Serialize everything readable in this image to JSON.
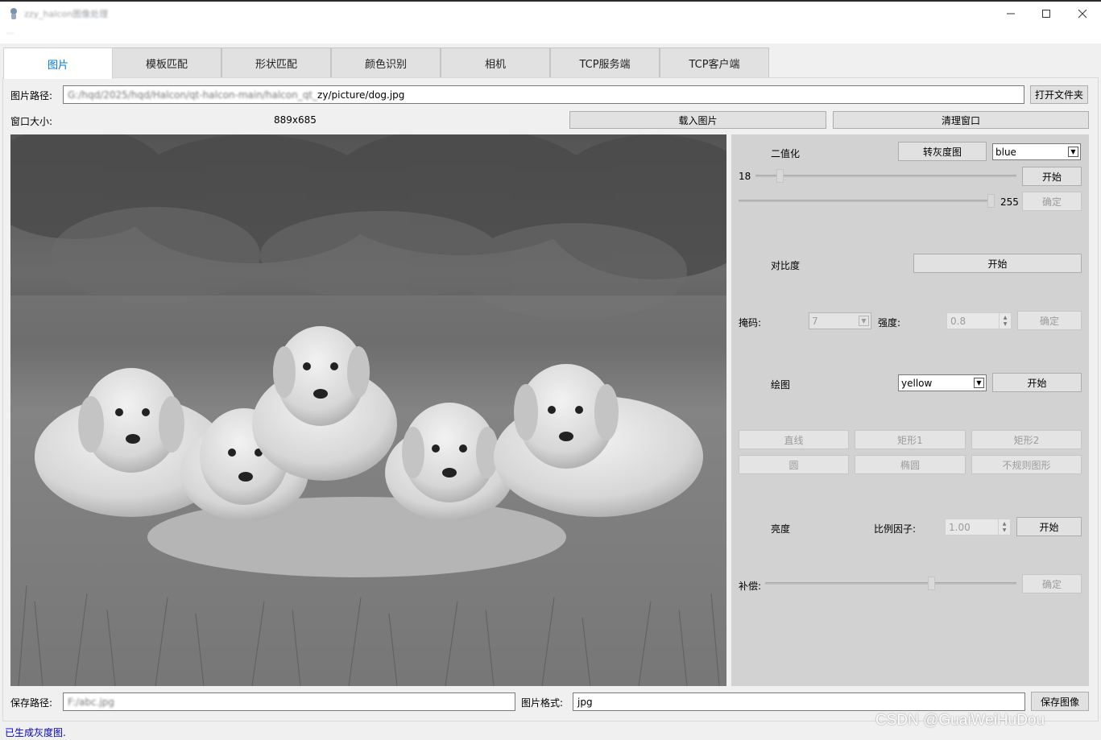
{
  "window": {
    "title": "zzy_halcon图像处理",
    "menu": "···",
    "minimize_icon": "minimize-icon",
    "maximize_icon": "maximize-icon",
    "close_icon": "close-icon"
  },
  "tabs": [
    {
      "label": "图片",
      "active": true
    },
    {
      "label": "模板匹配"
    },
    {
      "label": "形状匹配"
    },
    {
      "label": "颜色识别"
    },
    {
      "label": "相机"
    },
    {
      "label": "TCP服务端"
    },
    {
      "label": "TCP客户端"
    }
  ],
  "picture": {
    "path_label": "图片路径:",
    "path_prefix": "G:/hqd/2025/hqd/Halcon/qt-halcon-main/halcon_qt_",
    "path_value": "zy/picture/dog.jpg",
    "open_folder_label": "打开文件夹",
    "window_size_label": "窗口大小:",
    "window_size_value": "889x685",
    "load_image_label": "载入图片",
    "clear_window_label": "清理窗口"
  },
  "panel": {
    "binarize_label": "二值化",
    "to_gray_label": "转灰度图",
    "color_channel": "blue",
    "threshold_low": "18",
    "threshold_high": "255",
    "start_label": "开始",
    "confirm_label": "确定",
    "contrast_label": "对比度",
    "mask_label": "掩码:",
    "mask_value": "7",
    "strength_label": "强度:",
    "strength_value": "0.8",
    "draw_label": "绘图",
    "draw_color": "yellow",
    "shape_line": "直线",
    "shape_rect1": "矩形1",
    "shape_rect2": "矩形2",
    "shape_circle": "圆",
    "shape_ellipse": "椭圆",
    "shape_irregular": "不规则图形",
    "brightness_label": "亮度",
    "scale_factor_label": "比例因子:",
    "scale_factor_value": "1.00",
    "compensate_label": "补偿:",
    "threshold_low_fraction": 0.018,
    "threshold_high_fraction": 1.0,
    "compensate_fraction": 0.6
  },
  "bottom": {
    "save_path_label": "保存路径:",
    "save_path_value": "F:/abc.jpg",
    "format_label": "图片格式:",
    "format_value": "jpg",
    "save_image_label": "保存图像"
  },
  "status": "已生成灰度图.",
  "watermark": "CSDN @GuaiWeiHuDou",
  "colors": {
    "active_tab_text": "#0078d7",
    "status_text": "#0000cc",
    "panel_bg": "#d2d2d2"
  }
}
